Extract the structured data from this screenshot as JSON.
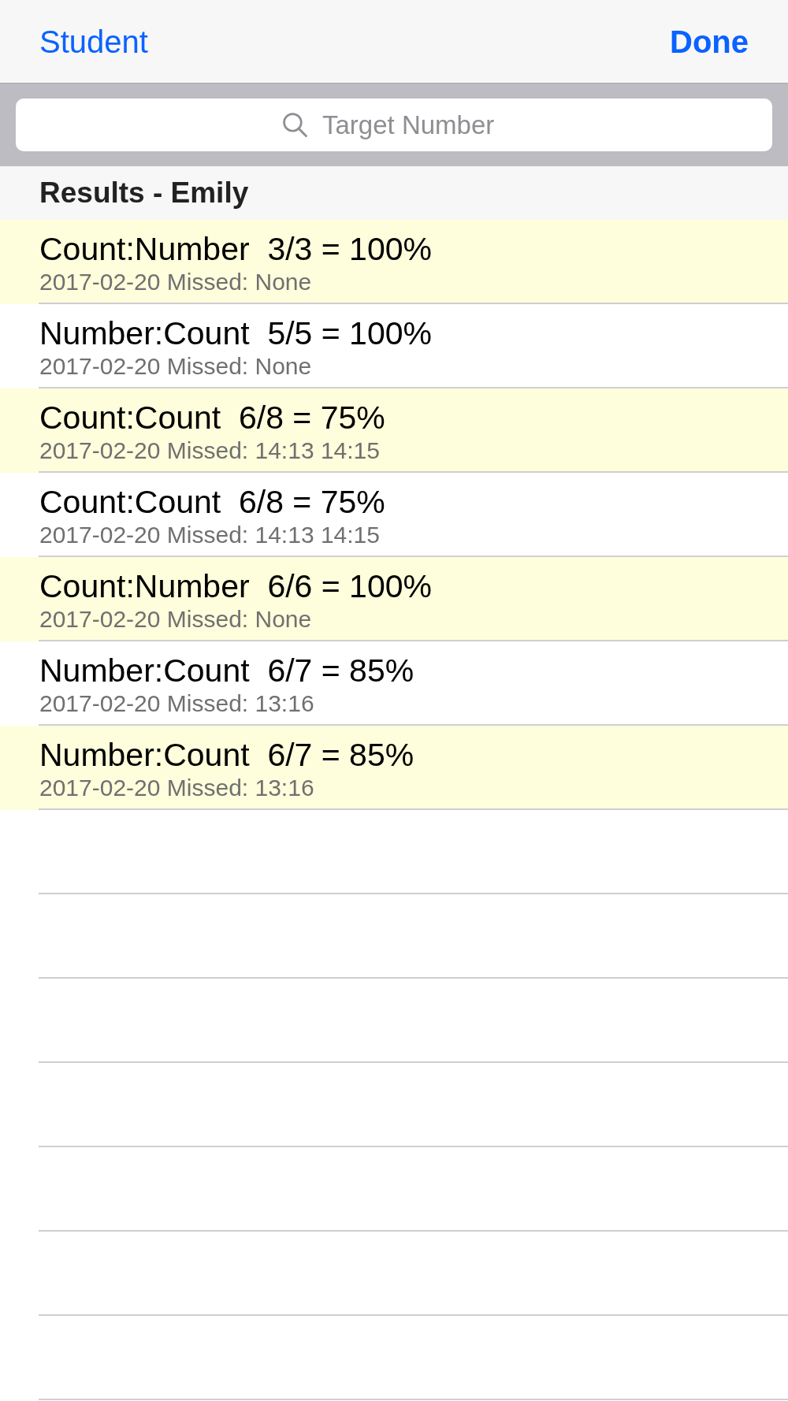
{
  "nav_bar": {
    "back_button": "Student",
    "done_button": "Done"
  },
  "search": {
    "placeholder": "Target Number"
  },
  "section": {
    "title": "Results - Emily"
  },
  "rows": [
    {
      "title": "Count:Number  3/3 = 100%",
      "detail": "2017-02-20 Missed: None",
      "highlighted": true
    },
    {
      "title": "Number:Count  5/5 = 100%",
      "detail": "2017-02-20 Missed: None",
      "highlighted": false
    },
    {
      "title": "Count:Count  6/8 = 75%",
      "detail": "2017-02-20 Missed: 14:13 14:15",
      "highlighted": true
    },
    {
      "title": "Count:Count  6/8 = 75%",
      "detail": "2017-02-20 Missed: 14:13 14:15",
      "highlighted": false
    },
    {
      "title": "Count:Number  6/6 = 100%",
      "detail": "2017-02-20 Missed: None",
      "highlighted": true
    },
    {
      "title": "Number:Count  6/7 = 85%",
      "detail": "2017-02-20 Missed: 13:16",
      "highlighted": false
    },
    {
      "title": "Number:Count  6/7 = 85%",
      "detail": "2017-02-20 Missed: 13:16",
      "highlighted": true
    }
  ]
}
